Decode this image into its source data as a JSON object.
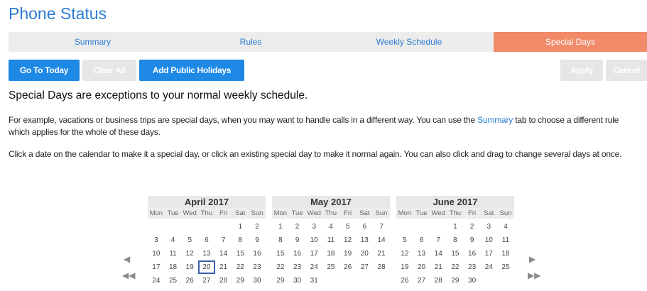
{
  "page_title": "Phone Status",
  "tabs": [
    {
      "label": "Summary",
      "active": false
    },
    {
      "label": "Rules",
      "active": false
    },
    {
      "label": "Weekly Schedule",
      "active": false
    },
    {
      "label": "Special Days",
      "active": true
    }
  ],
  "toolbar": {
    "go_to_today": "Go To Today",
    "clear_all": "Clear All",
    "add_public_holidays": "Add Public Holidays",
    "apply": "Apply",
    "cancel": "Cancel"
  },
  "content": {
    "heading": "Special Days are exceptions to your normal weekly schedule.",
    "para1_before": "For example, vacations or business trips are special days, when you may want to handle calls in a different way. You can use the ",
    "para1_link": "Summary",
    "para1_after": " tab to choose a different rule which applies for the whole of these days.",
    "para2": "Click a date on the calendar to make it a special day, or click an existing special day to make it normal again. You can also click and drag to change several days at once."
  },
  "calendar": {
    "weekdays": [
      "Mon",
      "Tue",
      "Wed",
      "Thu",
      "Fri",
      "Sat",
      "Sun"
    ],
    "months": [
      {
        "title": "April 2017",
        "offset": 5,
        "days": 30,
        "today": 20
      },
      {
        "title": "May 2017",
        "offset": 0,
        "days": 31,
        "today": null
      },
      {
        "title": "June 2017",
        "offset": 3,
        "days": 30,
        "today": null
      }
    ],
    "nav": {
      "prev": "◀",
      "prev_far": "◀◀",
      "next": "▶",
      "next_far": "▶▶"
    }
  },
  "colors": {
    "accent": "#1e88e5",
    "active_tab": "#f08a68",
    "link": "#2d7dd2"
  }
}
